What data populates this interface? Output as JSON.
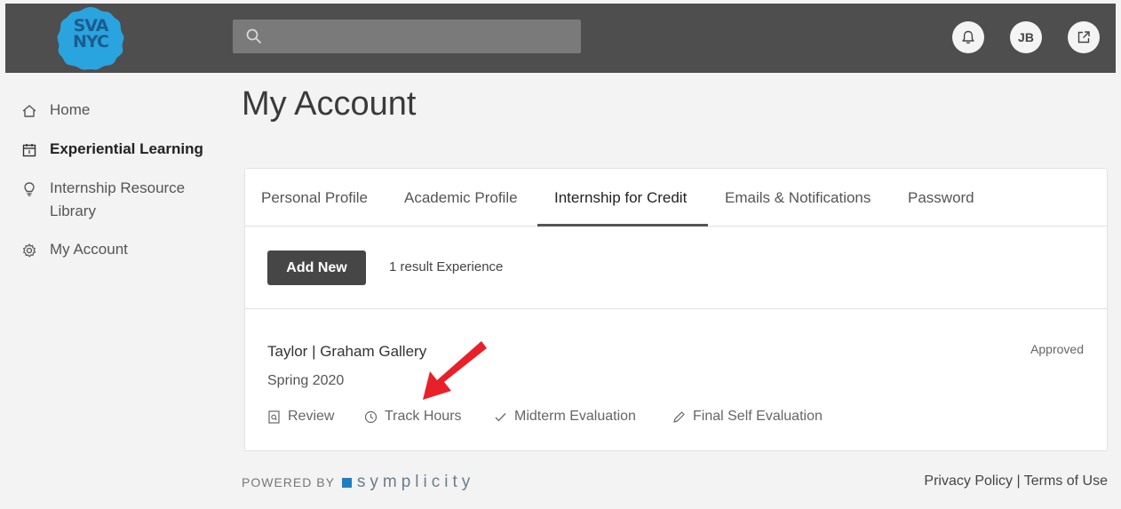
{
  "header": {
    "logo_text_line1": "SVA",
    "logo_text_line2": "NYC",
    "search": {
      "placeholder": "",
      "value": ""
    },
    "avatar_initials": "JB"
  },
  "sidebar": {
    "items": [
      {
        "label": "Home",
        "icon": "home-icon",
        "active": false
      },
      {
        "label": "Experiential Learning",
        "icon": "calendar-icon",
        "active": true
      },
      {
        "label": "Internship Resource Library",
        "icon": "lightbulb-icon",
        "active": false
      },
      {
        "label": "My Account",
        "icon": "gear-icon",
        "active": false
      }
    ],
    "item3_line1": "Internship Resource",
    "item3_line2": "Library"
  },
  "main": {
    "title": "My Account",
    "tabs": [
      {
        "label": "Personal Profile"
      },
      {
        "label": "Academic Profile"
      },
      {
        "label": "Internship for Credit"
      },
      {
        "label": "Emails & Notifications"
      },
      {
        "label": "Password"
      }
    ],
    "add_new_label": "Add New",
    "result_text": "1 result Experience",
    "experience": {
      "title": "Taylor | Graham Gallery",
      "term": "Spring 2020",
      "status": "Approved",
      "actions": [
        {
          "label": "Review",
          "icon": "document-search-icon"
        },
        {
          "label": "Track Hours",
          "icon": "clock-icon"
        },
        {
          "label": "Midterm Evaluation",
          "icon": "checkmark-icon"
        },
        {
          "label": "Final Self Evaluation",
          "icon": "pencil-icon"
        }
      ]
    }
  },
  "footer": {
    "powered_by": "POWERED BY",
    "brand": "symplicity",
    "links": "Privacy Policy | Terms of Use"
  },
  "colors": {
    "topbar": "#4e4e4e",
    "logo": "#2aa4df",
    "arrow": "#e8202a",
    "brand_square": "#1f7fc2"
  }
}
